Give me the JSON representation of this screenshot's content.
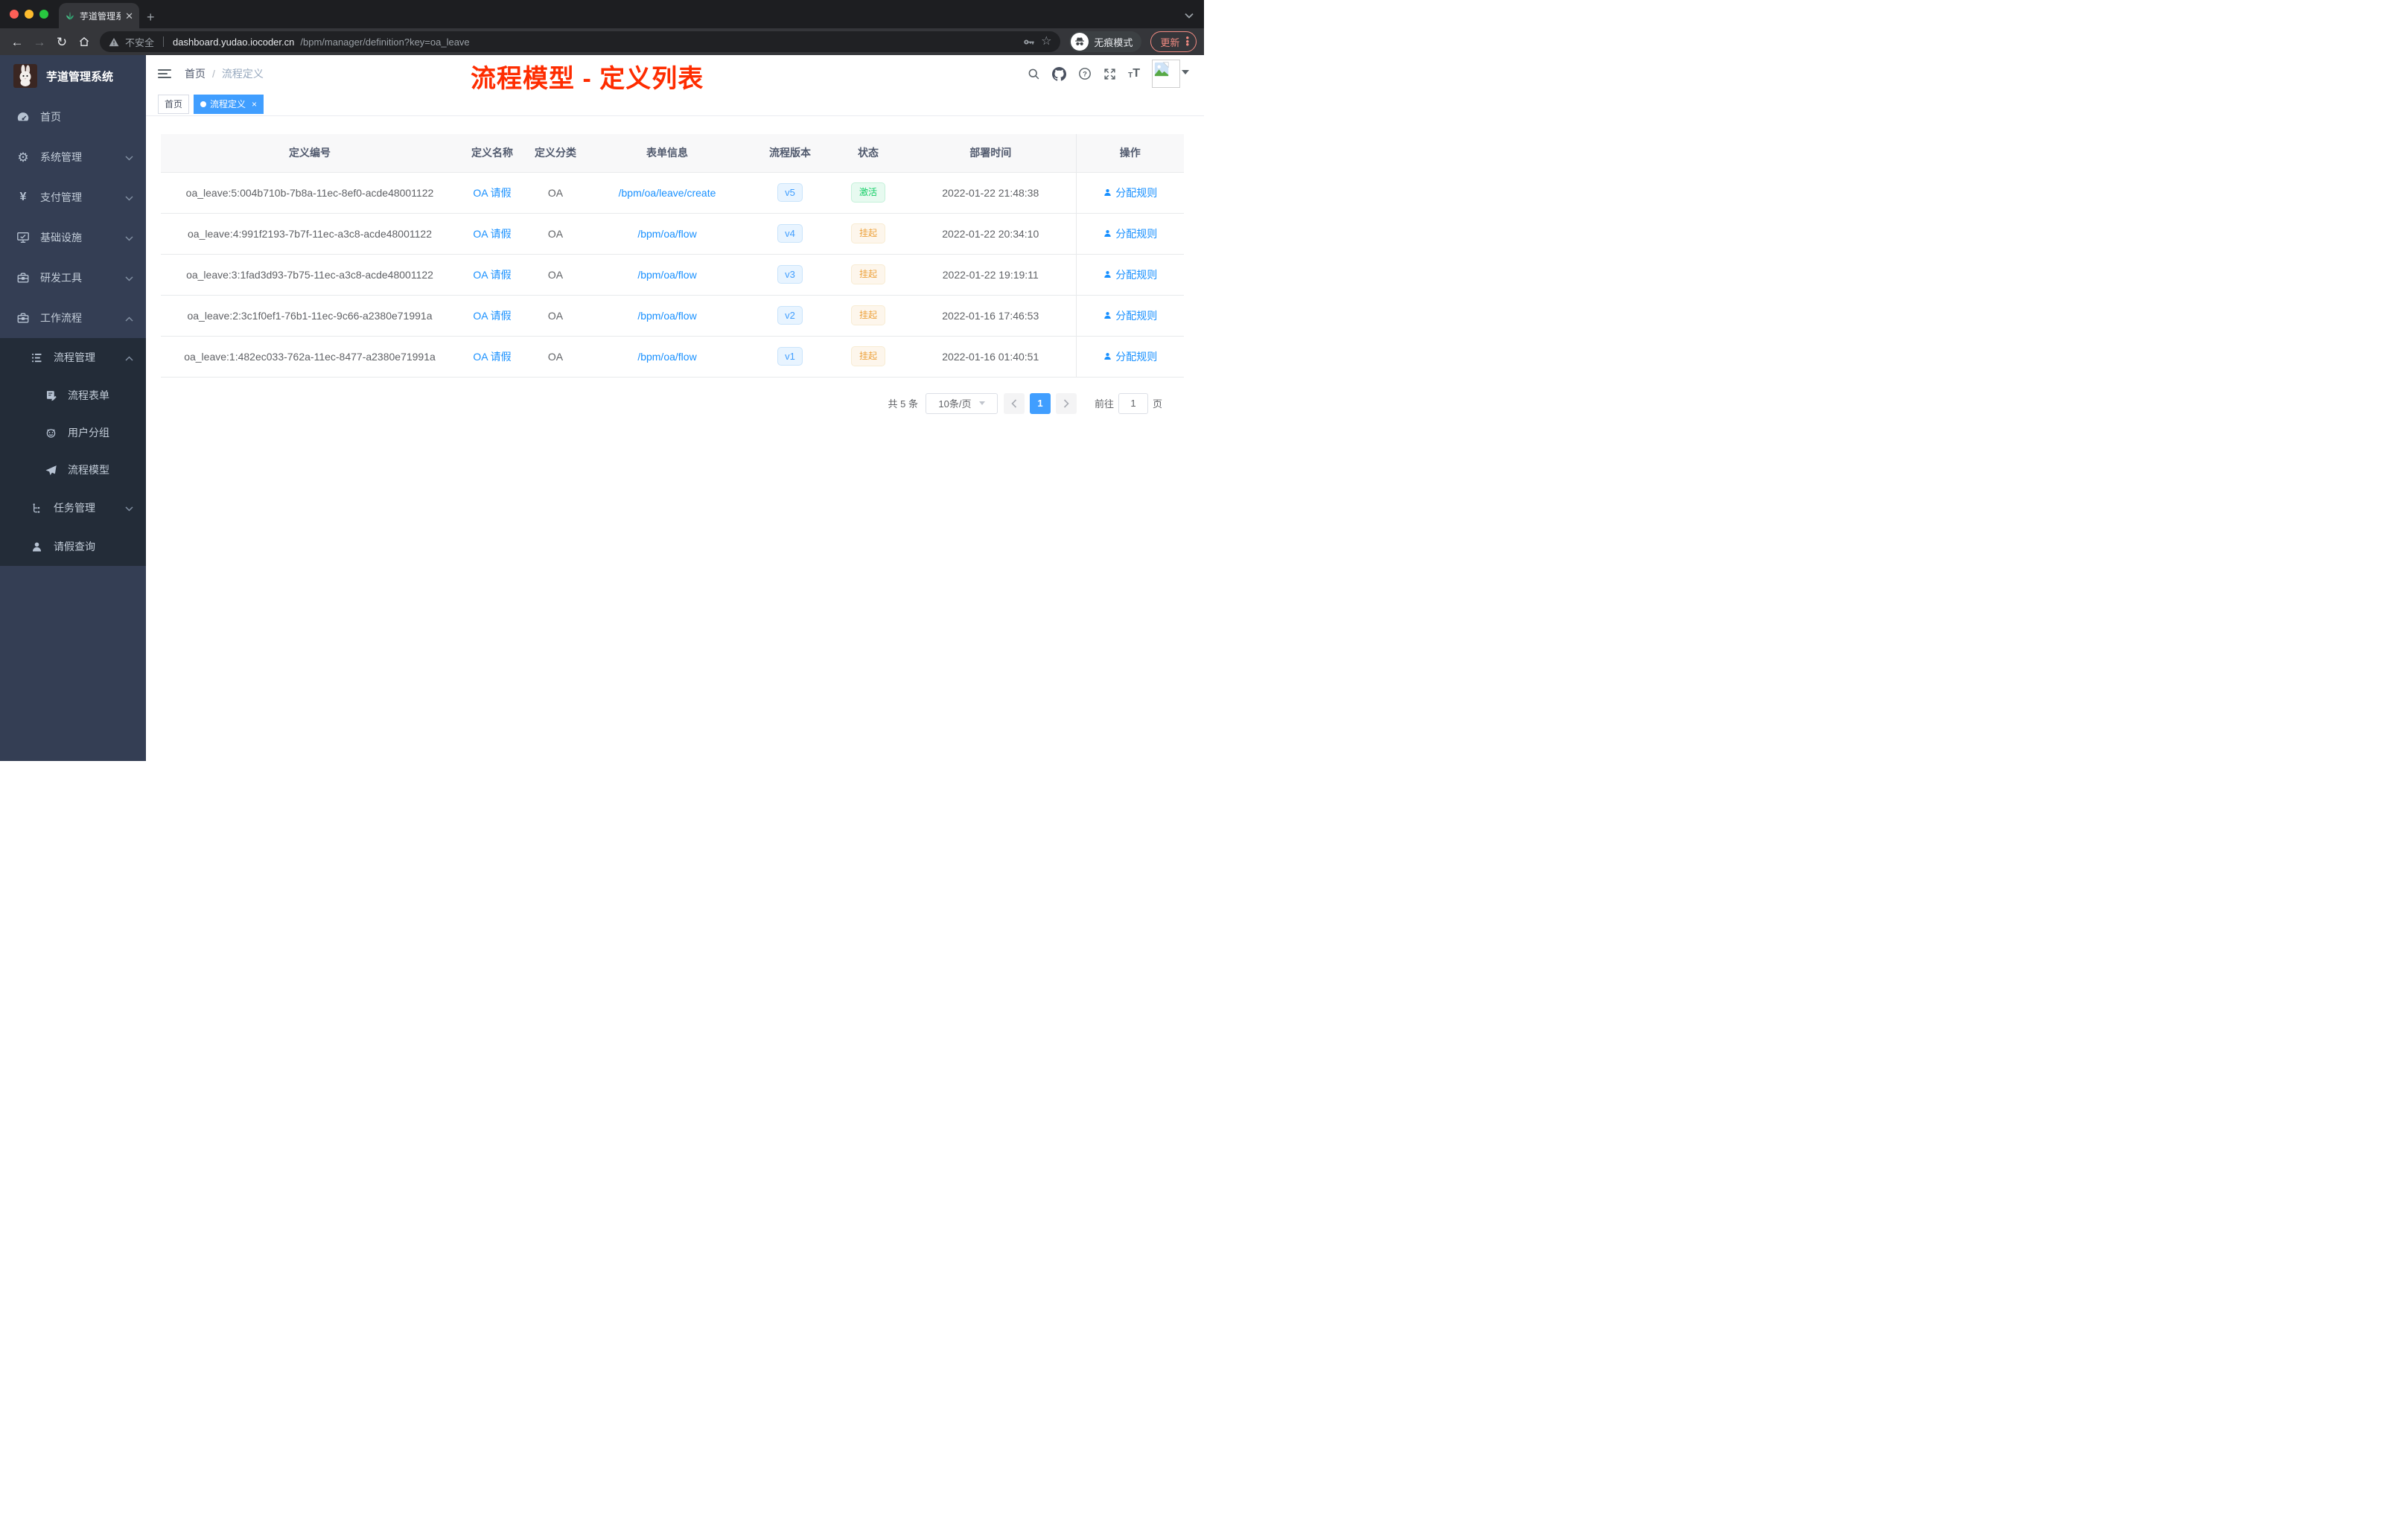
{
  "browser": {
    "tab_title": "芋道管理系统",
    "security_label": "不安全",
    "url_host": "dashboard.yudao.iocoder.cn",
    "url_path": "/bpm/manager/definition?key=oa_leave",
    "incognito_label": "无痕模式",
    "update_label": "更新"
  },
  "sidebar": {
    "logo_title": "芋道管理系统",
    "menu": [
      {
        "label": "首页",
        "icon": "dashboard-icon"
      },
      {
        "label": "系统管理",
        "icon": "gear-icon"
      },
      {
        "label": "支付管理",
        "icon": "yen-icon"
      },
      {
        "label": "基础设施",
        "icon": "monitor-icon"
      },
      {
        "label": "研发工具",
        "icon": "toolbox-icon"
      },
      {
        "label": "工作流程",
        "icon": "briefcase-icon"
      }
    ],
    "submenu": {
      "process_mgmt": "流程管理",
      "process_form": "流程表单",
      "user_group": "用户分组",
      "process_model": "流程模型",
      "task_mgmt": "任务管理",
      "leave_query": "请假查询"
    }
  },
  "header": {
    "breadcrumb_home": "首页",
    "breadcrumb_separator": "/",
    "breadcrumb_current": "流程定义",
    "annotation": "流程模型 - 定义列表"
  },
  "tags": {
    "home": "首页",
    "active": "流程定义",
    "close": "×"
  },
  "table": {
    "columns": {
      "id": "定义编号",
      "name": "定义名称",
      "category": "定义分类",
      "form": "表单信息",
      "version": "流程版本",
      "status": "状态",
      "deploy_time": "部署时间",
      "action": "操作"
    },
    "rows": [
      {
        "id": "oa_leave:5:004b710b-7b8a-11ec-8ef0-acde48001122",
        "name": "OA 请假",
        "category": "OA",
        "form": "/bpm/oa/leave/create",
        "version": "v5",
        "status": "激活",
        "status_type": "success",
        "deploy_time": "2022-01-22 21:48:38",
        "action": "分配规则"
      },
      {
        "id": "oa_leave:4:991f2193-7b7f-11ec-a3c8-acde48001122",
        "name": "OA 请假",
        "category": "OA",
        "form": "/bpm/oa/flow",
        "version": "v4",
        "status": "挂起",
        "status_type": "warning",
        "deploy_time": "2022-01-22 20:34:10",
        "action": "分配规则"
      },
      {
        "id": "oa_leave:3:1fad3d93-7b75-11ec-a3c8-acde48001122",
        "name": "OA 请假",
        "category": "OA",
        "form": "/bpm/oa/flow",
        "version": "v3",
        "status": "挂起",
        "status_type": "warning",
        "deploy_time": "2022-01-22 19:19:11",
        "action": "分配规则"
      },
      {
        "id": "oa_leave:2:3c1f0ef1-76b1-11ec-9c66-a2380e71991a",
        "name": "OA 请假",
        "category": "OA",
        "form": "/bpm/oa/flow",
        "version": "v2",
        "status": "挂起",
        "status_type": "warning",
        "deploy_time": "2022-01-16 17:46:53",
        "action": "分配规则"
      },
      {
        "id": "oa_leave:1:482ec033-762a-11ec-8477-a2380e71991a",
        "name": "OA 请假",
        "category": "OA",
        "form": "/bpm/oa/flow",
        "version": "v1",
        "status": "挂起",
        "status_type": "warning",
        "deploy_time": "2022-01-16 01:40:51",
        "action": "分配规则"
      }
    ]
  },
  "pagination": {
    "total": "共 5 条",
    "page_size": "10条/页",
    "current_page": "1",
    "goto_label": "前往",
    "goto_value": "1",
    "page_unit": "页"
  },
  "colors": {
    "primary": "#409eff",
    "link": "#1890ff",
    "success": "#13ce66",
    "warning": "#e6a23c",
    "annotation_red": "#fe2c00",
    "sidebar_bg": "#343e54",
    "submenu_bg": "#232c38"
  }
}
